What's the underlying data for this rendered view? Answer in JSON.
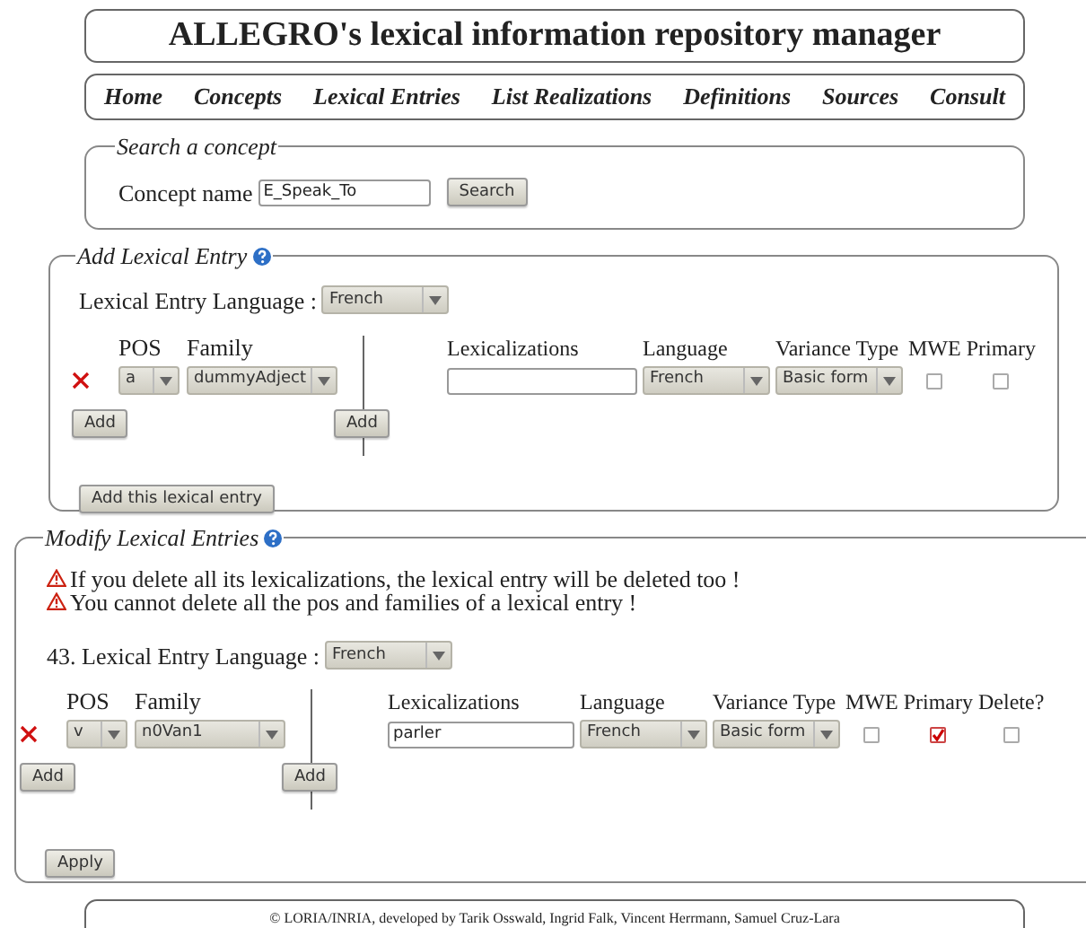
{
  "header": {
    "title": "ALLEGRO's lexical information repository manager"
  },
  "nav": [
    {
      "label": "Home"
    },
    {
      "label": "Concepts"
    },
    {
      "label": "Lexical Entries"
    },
    {
      "label": "List Realizations"
    },
    {
      "label": "Definitions"
    },
    {
      "label": "Sources"
    },
    {
      "label": "Consult"
    }
  ],
  "search": {
    "legend": "Search a concept",
    "label": "Concept name",
    "value": "E_Speak_To",
    "button": "Search"
  },
  "add_entry": {
    "legend": "Add Lexical Entry",
    "language_label": "Lexical Entry Language :",
    "language": "French",
    "pos_headers": [
      "POS",
      "Family"
    ],
    "pos_rows": [
      {
        "pos": "a",
        "family": "dummyAdject"
      }
    ],
    "add_pos_button": "Add",
    "lex_headers": [
      "Lexicalizations",
      "Language",
      "Variance Type",
      "MWE",
      "Primary"
    ],
    "lex_rows": [
      {
        "value": "",
        "language": "French",
        "variance": "Basic form",
        "mwe": false,
        "primary": false
      }
    ],
    "add_lex_button": "Add",
    "submit_button": "Add this lexical entry"
  },
  "modify": {
    "legend": "Modify Lexical Entries",
    "warnings": [
      "If you delete all its lexicalizations, the lexical entry will be deleted too !",
      "You cannot delete all the pos and families of a lexical entry !"
    ],
    "entries": [
      {
        "label": "43. Lexical Entry Language :",
        "language": "French",
        "pos_headers": [
          "POS",
          "Family"
        ],
        "pos_rows": [
          {
            "pos": "v",
            "family": "n0Van1"
          }
        ],
        "add_pos_button": "Add",
        "lex_headers": [
          "Lexicalizations",
          "Language",
          "Variance Type",
          "MWE",
          "Primary",
          "Delete?"
        ],
        "lex_rows": [
          {
            "value": "parler",
            "language": "French",
            "variance": "Basic form",
            "mwe": false,
            "primary": true,
            "delete": false
          }
        ],
        "add_lex_button": "Add"
      }
    ],
    "apply_button": "Apply"
  },
  "footer": {
    "text": "© LORIA/INRIA, developed by Tarik Osswald, Ingrid Falk, Vincent Herrmann, Samuel Cruz-Lara"
  }
}
